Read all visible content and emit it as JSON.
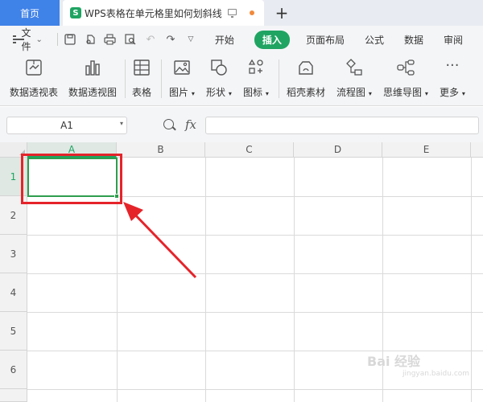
{
  "titlebar": {
    "home_tab": "首页",
    "doc_tab_icon": "S",
    "doc_tab_title": "WPS表格在单元格里如何划斜线",
    "plus_label": "+"
  },
  "menubar": {
    "file_label": "文件",
    "tabs": [
      "开始",
      "插入",
      "页面布局",
      "公式",
      "数据",
      "审阅"
    ],
    "active_tab": "插入"
  },
  "ribbon": {
    "buttons": [
      {
        "label": "数据透视表",
        "icon": "pivot-table-icon"
      },
      {
        "label": "数据透视图",
        "icon": "pivot-chart-icon"
      },
      {
        "label": "表格",
        "icon": "table-icon"
      },
      {
        "label": "图片",
        "icon": "picture-icon",
        "dropdown": true
      },
      {
        "label": "形状",
        "icon": "shape-icon",
        "dropdown": true
      },
      {
        "label": "图标",
        "icon": "icons-icon",
        "dropdown": true
      },
      {
        "label": "稻壳素材",
        "icon": "material-icon"
      },
      {
        "label": "流程图",
        "icon": "flowchart-icon",
        "dropdown": true
      },
      {
        "label": "思维导图",
        "icon": "mindmap-icon",
        "dropdown": true
      },
      {
        "label": "更多",
        "icon": "more-icon",
        "dropdown": true
      }
    ]
  },
  "formulabar": {
    "cell_ref": "A1",
    "fx_label": "fx",
    "formula_value": ""
  },
  "grid": {
    "columns": [
      "A",
      "B",
      "C",
      "D",
      "E"
    ],
    "rows": [
      "1",
      "2",
      "3",
      "4",
      "5",
      "6"
    ],
    "selected_cell": "A1"
  },
  "colors": {
    "accent_green": "#1fa462",
    "selection_green": "#2e9e4e",
    "annotation_red": "#e5242a",
    "home_tab_blue": "#3f82e8"
  },
  "watermark": {
    "text": "Bai 经验",
    "sub": "jingyan.baidu.com"
  }
}
